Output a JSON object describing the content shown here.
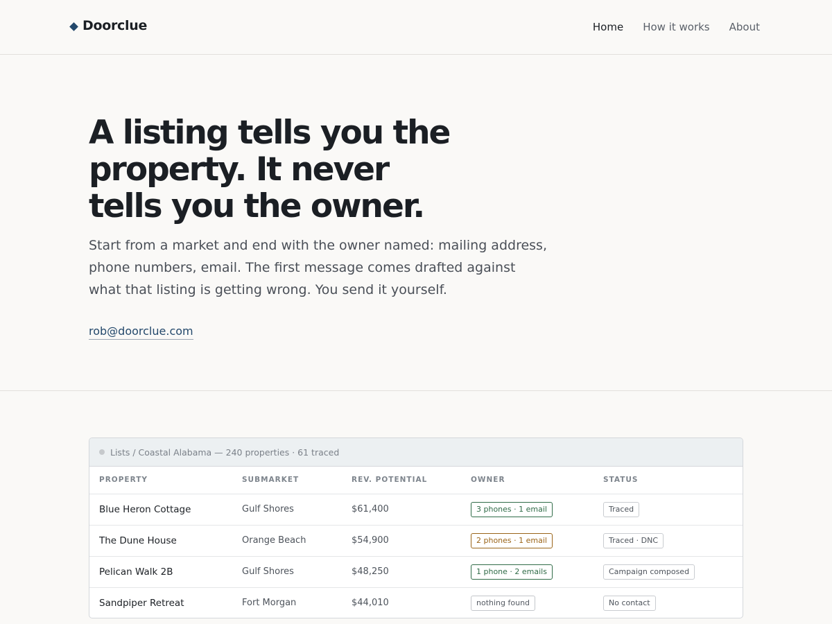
{
  "header": {
    "brand": "Doorclue",
    "nav": [
      {
        "label": "Home",
        "active": true
      },
      {
        "label": "How it works",
        "active": false
      },
      {
        "label": "About",
        "active": false
      }
    ]
  },
  "hero": {
    "headline_lines": [
      "A listing tells you the",
      "property. It never",
      "tells you the owner."
    ],
    "lede_lines": [
      "Start from a market and end with the owner named: mailing address,",
      "phone numbers, email. The first message comes drafted against",
      "what that listing is getting wrong. You send it yourself."
    ],
    "contact_email": "rob@doorclue.com"
  },
  "table": {
    "breadcrumb": "Lists / Coastal Alabama — 240 properties · 61 traced",
    "columns": [
      "PROPERTY",
      "SUBMARKET",
      "REV. POTENTIAL",
      "OWNER",
      "STATUS"
    ],
    "rows": [
      {
        "property": "Blue Heron Cottage",
        "submarket": "Gulf Shores",
        "revenue": "$61,400",
        "owner": "3 phones · 1 email",
        "owner_tone": "green",
        "status": "Traced"
      },
      {
        "property": "The Dune House",
        "submarket": "Orange Beach",
        "revenue": "$54,900",
        "owner": "2 phones · 1 email",
        "owner_tone": "amber",
        "status": "Traced · DNC"
      },
      {
        "property": "Pelican Walk 2B",
        "submarket": "Gulf Shores",
        "revenue": "$48,250",
        "owner": "1 phone · 2 emails",
        "owner_tone": "green",
        "status": "Campaign composed"
      },
      {
        "property": "Sandpiper Retreat",
        "submarket": "Fort Morgan",
        "revenue": "$44,010",
        "owner": "nothing found",
        "owner_tone": "gray",
        "status": "No contact"
      }
    ]
  },
  "colors": {
    "accent": "#23486b",
    "green": "#2f6b47",
    "amber": "#9a6418",
    "background": "#faf9f7"
  }
}
